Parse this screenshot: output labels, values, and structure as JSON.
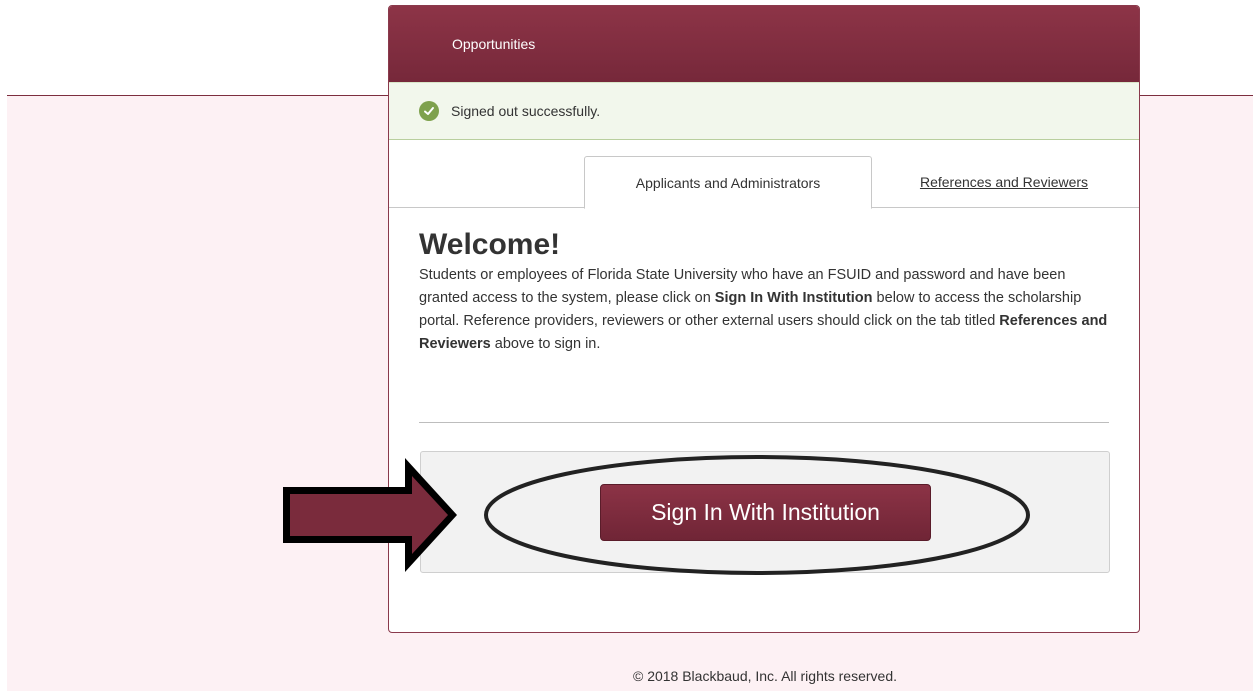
{
  "header": {
    "title": "Opportunities"
  },
  "alert": {
    "message": "Signed out successfully."
  },
  "tabs": [
    {
      "label": "Applicants and Administrators",
      "active": true
    },
    {
      "label": "References and Reviewers",
      "active": false
    }
  ],
  "welcome": {
    "heading": "Welcome!",
    "text_1": "Students or employees of Florida State University who have an FSUID and password and have been granted access to the system, please click on ",
    "bold_1": "Sign In With Institution",
    "text_2": " below to access the scholarship portal. Reference providers, reviewers or other external users should click on the tab titled ",
    "bold_2": "References and Reviewers",
    "text_3": " above to sign in."
  },
  "signin": {
    "button_label": "Sign In With Institution"
  },
  "footer": {
    "copyright": "© 2018 Blackbaud, Inc. All rights reserved."
  },
  "colors": {
    "brand": "#7d2e3f",
    "success": "#7ea14d",
    "background_pink": "#fdf1f4"
  },
  "icons": {
    "alert_icon": "check-circle-icon",
    "annotation_arrow": "arrow-right-icon"
  }
}
